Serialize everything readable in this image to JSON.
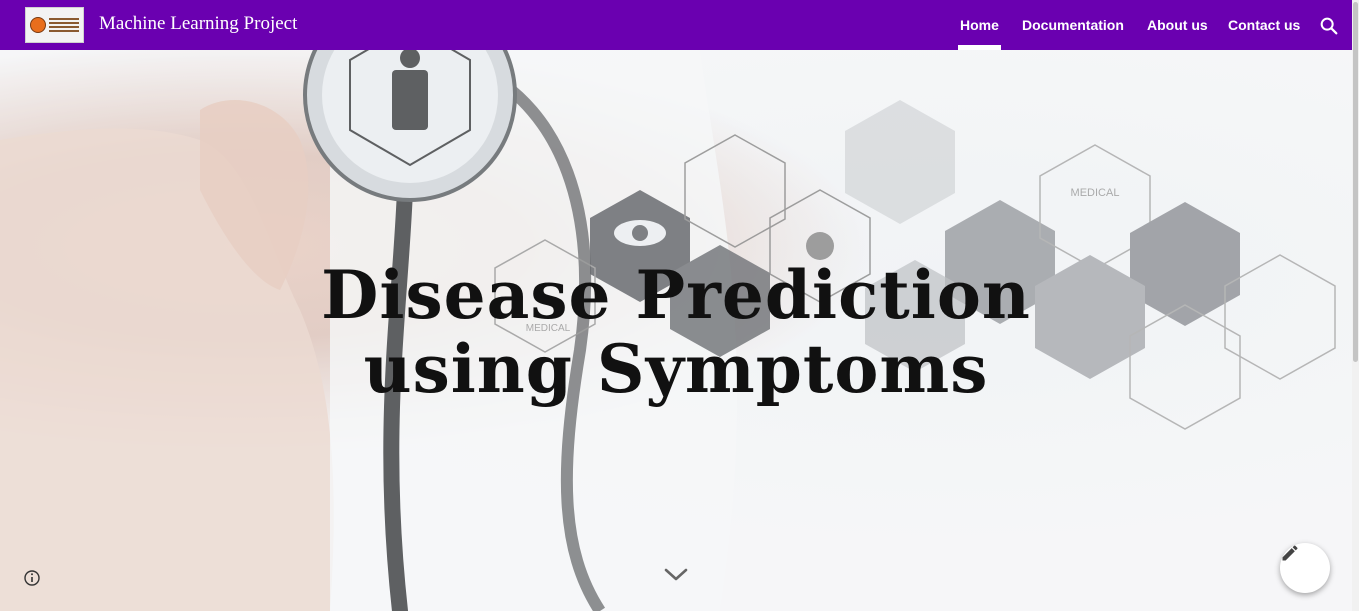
{
  "header": {
    "site_title": "Machine Learning Project",
    "logo_alt": "Lovely Professional University logo",
    "nav": [
      {
        "label": "Home",
        "active": true
      },
      {
        "label": "Documentation",
        "active": false
      },
      {
        "label": "About us",
        "active": false
      },
      {
        "label": "Contact us",
        "active": false
      }
    ],
    "search_icon": "search-icon"
  },
  "hero": {
    "title_line1": "Disease Prediction",
    "title_line2": "using Symptoms",
    "background_image": "doctor-stethoscope-medical-hexagon-icons",
    "hex_labels": [
      "MEDICAL",
      "MEDICAL"
    ]
  },
  "controls": {
    "scroll_icon": "chevron-down-icon",
    "info_icon": "info-icon",
    "edit_icon": "pencil-icon"
  },
  "colors": {
    "header_bg": "#6a00b0",
    "header_text": "#ffffff",
    "title_text": "#111111"
  }
}
